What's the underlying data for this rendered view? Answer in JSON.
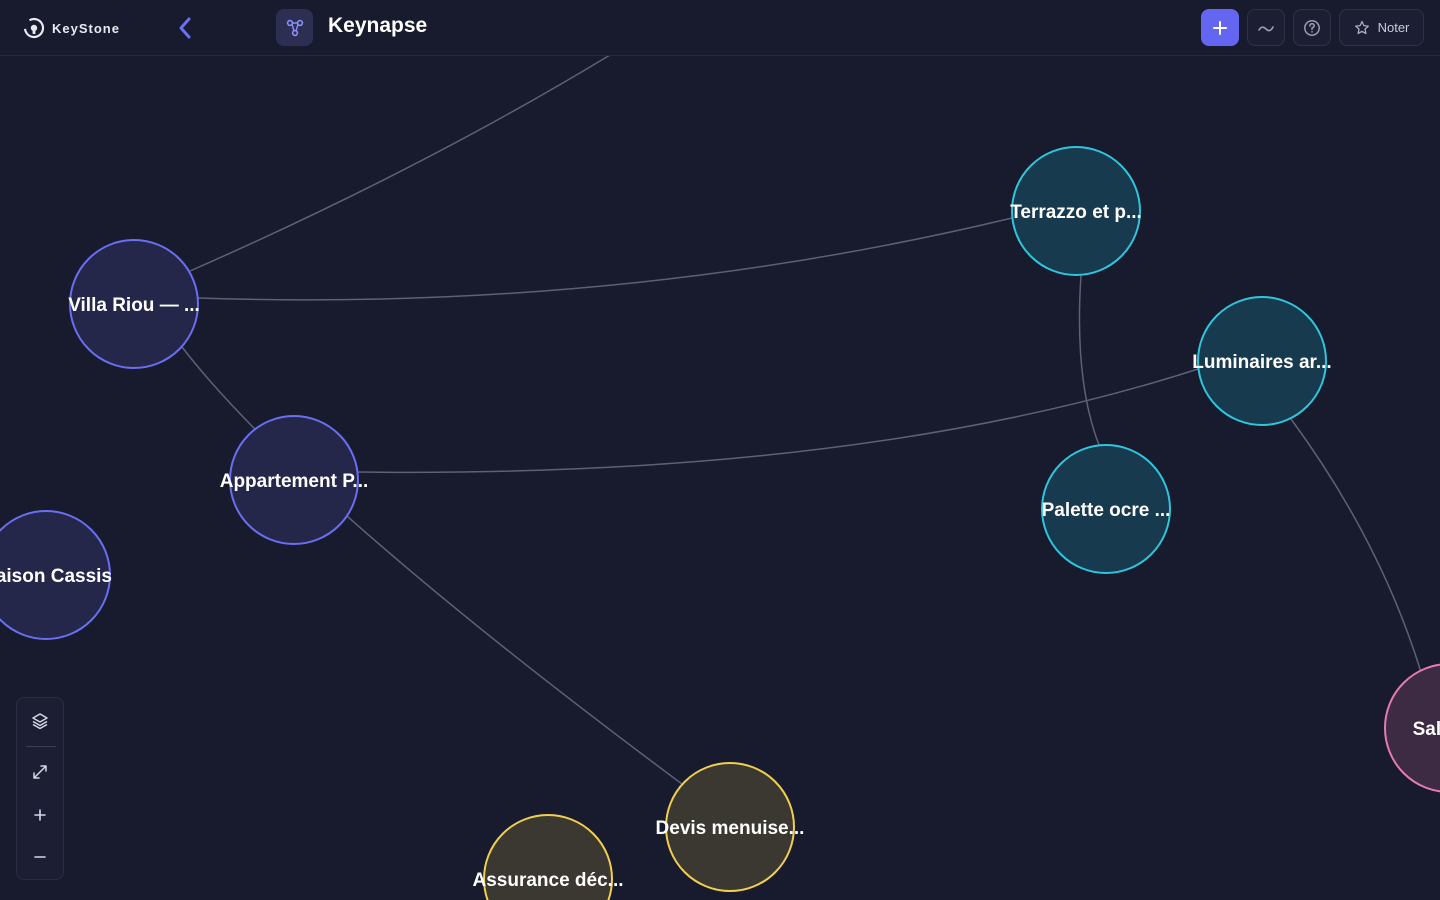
{
  "app": {
    "brand": "KeyStone",
    "title": "Keynapse"
  },
  "toolbar": {
    "noter_label": "Noter"
  },
  "colors": {
    "accent": "#6466f1",
    "project": "#6a6ef0",
    "material": "#2ec6dc",
    "document": "#f0cf4e",
    "client": "#e57ab5"
  },
  "nodes": [
    {
      "id": "villa",
      "label": "Villa Riou — ...",
      "kind": "project"
    },
    {
      "id": "appart",
      "label": "Appartement P...",
      "kind": "project"
    },
    {
      "id": "maison",
      "label": "Maison Cassis",
      "kind": "project"
    },
    {
      "id": "terrazzo",
      "label": "Terrazzo et p...",
      "kind": "material"
    },
    {
      "id": "luminaires",
      "label": "Luminaires ar...",
      "kind": "material"
    },
    {
      "id": "palette",
      "label": "Palette ocre ...",
      "kind": "material"
    },
    {
      "id": "devis",
      "label": "Devis menuise...",
      "kind": "document"
    },
    {
      "id": "assurance",
      "label": "Assurance déc...",
      "kind": "document"
    },
    {
      "id": "salon",
      "label": "Salon M",
      "kind": "client"
    }
  ],
  "links": [
    [
      "villa",
      "terrazzo"
    ],
    [
      "villa",
      "devis"
    ],
    [
      "appart",
      "luminaires"
    ],
    [
      "terrazzo",
      "palette"
    ],
    [
      "luminaires",
      "salon"
    ]
  ]
}
